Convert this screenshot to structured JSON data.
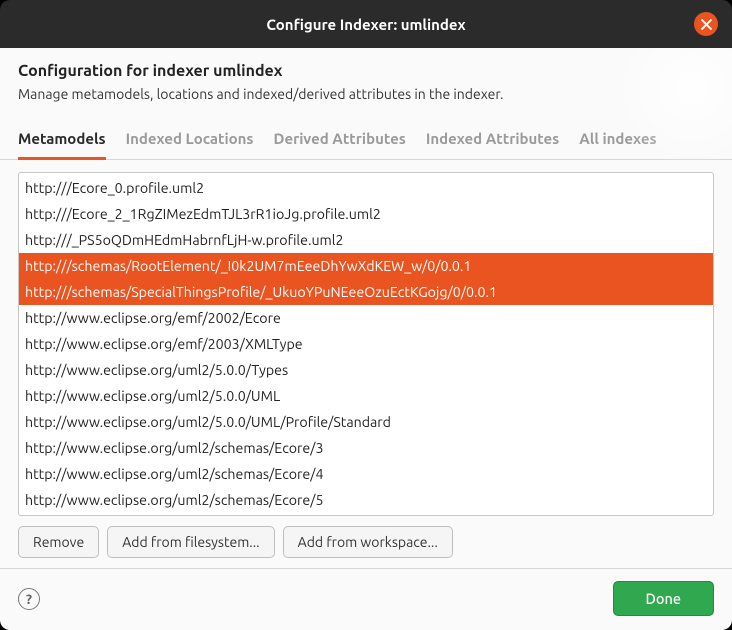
{
  "title": "Configure Indexer: umlindex",
  "header": {
    "heading": "Configuration for indexer umlindex",
    "subheading": "Manage metamodels, locations and indexed/derived attributes in the indexer."
  },
  "tabs": [
    {
      "label": "Metamodels",
      "active": true
    },
    {
      "label": "Indexed Locations",
      "active": false
    },
    {
      "label": "Derived Attributes",
      "active": false
    },
    {
      "label": "Indexed Attributes",
      "active": false
    },
    {
      "label": "All indexes",
      "active": false
    }
  ],
  "metamodels": {
    "items": [
      {
        "url": "http:///Ecore_0.profile.uml2",
        "selected": false
      },
      {
        "url": "http:///Ecore_2_1RgZIMezEdmTJL3rR1ioJg.profile.uml2",
        "selected": false
      },
      {
        "url": "http:///_PS5oQDmHEdmHabrnfLjH-w.profile.uml2",
        "selected": false
      },
      {
        "url": "http:///schemas/RootElement/_I0k2UM7mEeeDhYwXdKEW_w/0/0.0.1",
        "selected": true
      },
      {
        "url": "http:///schemas/SpecialThingsProfile/_UkuoYPuNEeeOzuEctKGojg/0/0.0.1",
        "selected": true
      },
      {
        "url": "http://www.eclipse.org/emf/2002/Ecore",
        "selected": false
      },
      {
        "url": "http://www.eclipse.org/emf/2003/XMLType",
        "selected": false
      },
      {
        "url": "http://www.eclipse.org/uml2/5.0.0/Types",
        "selected": false
      },
      {
        "url": "http://www.eclipse.org/uml2/5.0.0/UML",
        "selected": false
      },
      {
        "url": "http://www.eclipse.org/uml2/5.0.0/UML/Profile/Standard",
        "selected": false
      },
      {
        "url": "http://www.eclipse.org/uml2/schemas/Ecore/3",
        "selected": false
      },
      {
        "url": "http://www.eclipse.org/uml2/schemas/Ecore/4",
        "selected": false
      },
      {
        "url": "http://www.eclipse.org/uml2/schemas/Ecore/5",
        "selected": false
      }
    ]
  },
  "buttons": {
    "remove": "Remove",
    "add_fs": "Add from filesystem...",
    "add_ws": "Add from workspace..."
  },
  "footer": {
    "help_tooltip": "?",
    "done": "Done"
  },
  "colors": {
    "accent": "#e95420",
    "primary_action": "#2fa84f"
  }
}
